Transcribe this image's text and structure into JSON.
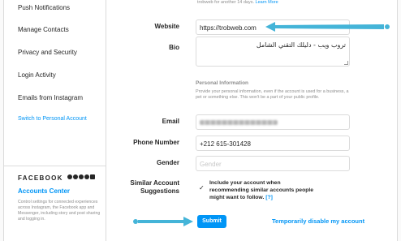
{
  "sidebar": {
    "items": [
      {
        "label": "Push Notifications"
      },
      {
        "label": "Manage Contacts"
      },
      {
        "label": "Privacy and Security"
      },
      {
        "label": "Login Activity"
      },
      {
        "label": "Emails from Instagram"
      },
      {
        "label": "Switch to Personal Account"
      }
    ],
    "brand": "FACEBOOK",
    "accounts_center": "Accounts Center",
    "accounts_desc": "Control settings for connected experiences across Instagram, the Facebook app and Messenger, including story and post sharing and logging in."
  },
  "header_note": {
    "text": "trobweb for another 14 days.",
    "link": "Learn More"
  },
  "form": {
    "website": {
      "label": "Website",
      "value": "https://trobweb.com"
    },
    "bio": {
      "label": "Bio",
      "value": "تروب ويب - دليلك التقني الشامل"
    },
    "personal_info": {
      "heading": "Personal Information",
      "desc": "Provide your personal information, even if the account is used for a business, a pet or something else. This won't be a part of your public profile."
    },
    "email": {
      "label": "Email"
    },
    "phone": {
      "label": "Phone Number",
      "value": "+212 615-301428"
    },
    "gender": {
      "label": "Gender",
      "placeholder": "Gender"
    },
    "similar": {
      "label_line1": "Similar Account",
      "label_line2": "Suggestions",
      "checked": true,
      "text": "Include your account when recommending similar accounts people might want to follow.",
      "help": "[?]"
    },
    "submit_label": "Submit",
    "disable_label": "Temporarily disable my account"
  },
  "colors": {
    "accent": "#0095f6",
    "arrow": "#44b4d8",
    "border": "#dbdbdb"
  }
}
